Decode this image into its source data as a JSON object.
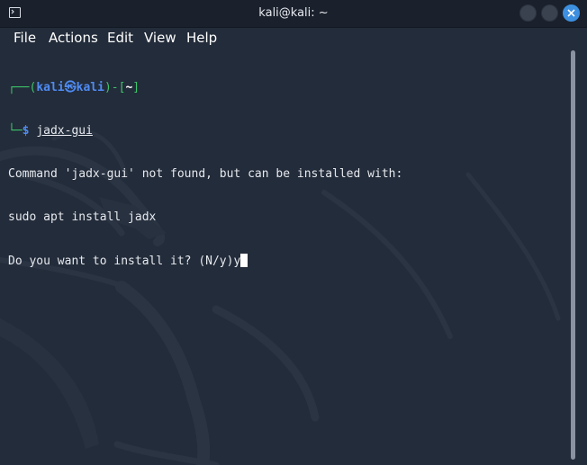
{
  "window": {
    "title": "kali@kali: ~",
    "app_icon": "terminal-icon",
    "buttons": [
      "minimize-icon",
      "maximize-icon",
      "close-icon"
    ],
    "accent_color": "#3d8fe0"
  },
  "menu": {
    "items": [
      {
        "label": "File"
      },
      {
        "label": "Actions"
      },
      {
        "label": "Edit"
      },
      {
        "label": "View"
      },
      {
        "label": "Help"
      }
    ]
  },
  "terminal": {
    "prompt": {
      "corner_top": "┌──(",
      "user": "kali",
      "at_symbol": "㉿",
      "host": "kali",
      "close_paren": ")-[",
      "path": "~",
      "close_bracket": "]",
      "corner_bottom": "└─",
      "dollar": "$",
      "command": "jadx-gui"
    },
    "output": [
      "Command 'jadx-gui' not found, but can be installed with:",
      "sudo apt install jadx",
      "Do you want to install it? (N/y)y"
    ],
    "colors": {
      "background": "#232c3a",
      "prompt_frame": "#3ec46a",
      "prompt_user": "#4f8bf2",
      "text": "#e6e9ee"
    }
  }
}
